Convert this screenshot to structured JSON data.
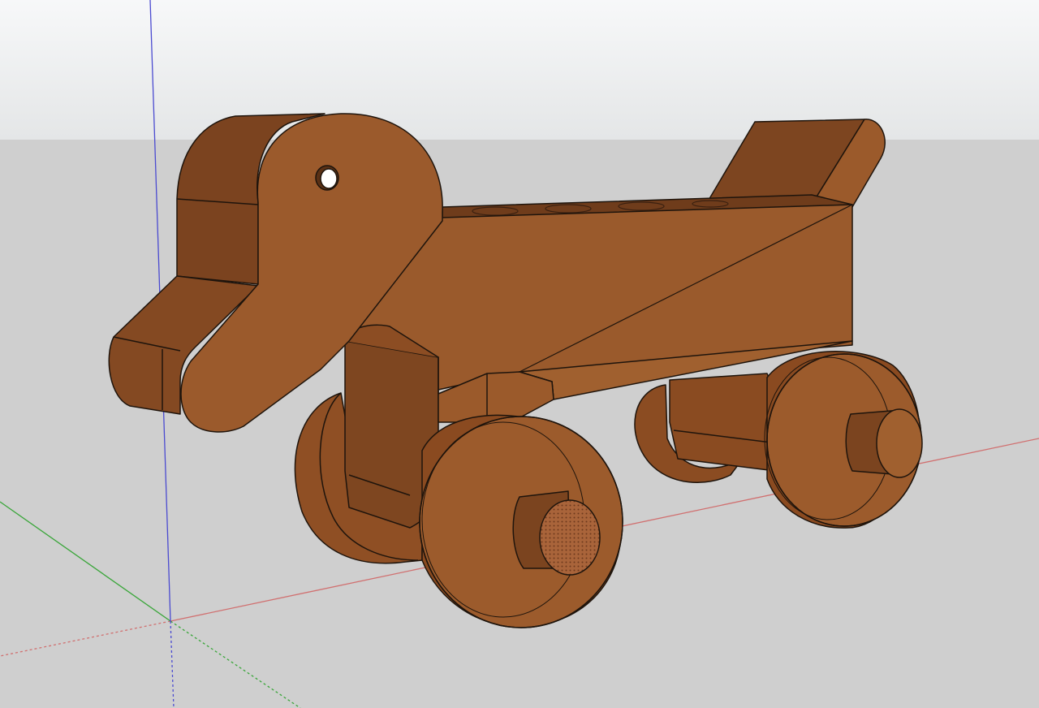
{
  "app": {
    "view": "3d-model-viewport",
    "model": "wooden-toy-duck-on-wheels"
  },
  "colors": {
    "sky_top": "#f4f5f6",
    "sky_bottom": "#e7e8e9",
    "ground": "#cfcfcf",
    "wood_face": "#9a5a2c",
    "wood_side": "#7e4620",
    "wood_light": "#a8652f",
    "outline": "#1e140c",
    "axis_red": "#d06060",
    "axis_green": "#3aa63a",
    "axis_blue": "#4040c0"
  },
  "axes": {
    "red": "red-axis",
    "green": "green-axis",
    "blue": "blue-axis"
  }
}
